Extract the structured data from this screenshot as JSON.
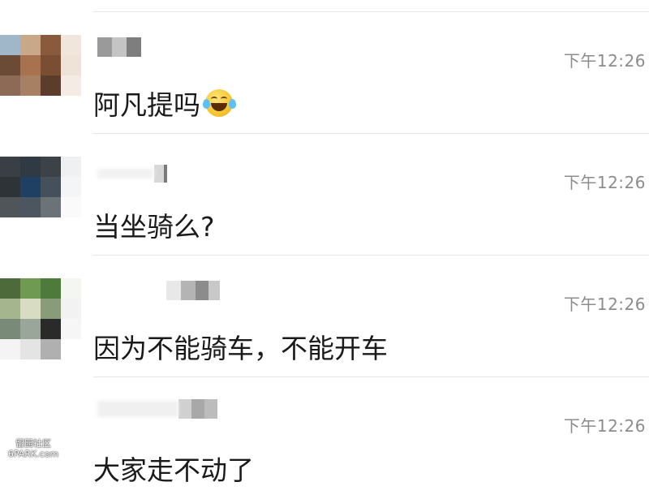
{
  "comments": [
    {
      "time": "下午12:26",
      "text": "阿凡提吗",
      "emoji": "laughing-tears-emoji"
    },
    {
      "time": "下午12:26",
      "text": "当坐骑么?"
    },
    {
      "time": "下午12:26",
      "text": "因为不能骑车，不能开车"
    },
    {
      "time": "下午12:26",
      "text": "大家走不动了"
    }
  ],
  "watermark": {
    "line1": "留园社区",
    "line2": "6PARK.com"
  },
  "colors": {
    "text": "#1a1a1a",
    "time": "#8c8c8c",
    "divider": "#e6e6e6"
  }
}
